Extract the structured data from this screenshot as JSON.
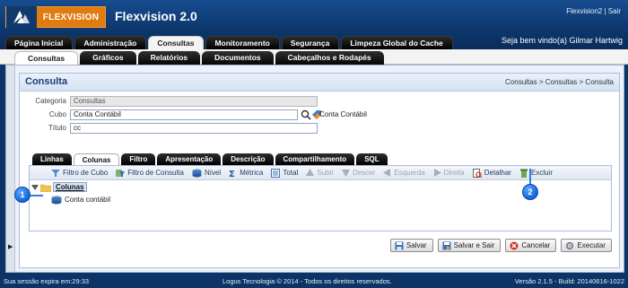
{
  "header": {
    "logo_text": "FLEXVISION",
    "app_title": "Flexvision 2.0",
    "user_link": "Flexvision2",
    "separator": "|",
    "exit_link": "Sair",
    "welcome": "Seja bem vindo(a) Gilmar Hartwig"
  },
  "main_tabs": [
    "Página Inicial",
    "Administração",
    "Consultas",
    "Monitoramento",
    "Segurança",
    "Limpeza Global do Cache"
  ],
  "sub_tabs": [
    "Consultas",
    "Gráficos",
    "Relatórios",
    "Documentos",
    "Cabeçalhos e Rodapés"
  ],
  "panel": {
    "title": "Consulta",
    "breadcrumb": "Consultas > Consultas > Consulta"
  },
  "form": {
    "categoria_label": "Categoria",
    "categoria_value": "Consultas",
    "cubo_label": "Cubo",
    "cubo_value": "Conta Contábil",
    "cubo_selected": "Conta Contábil",
    "titulo_label": "Título",
    "titulo_value": "cc"
  },
  "inner_tabs": [
    "Linhas",
    "Colunas",
    "Filtro",
    "Apresentação",
    "Descrição",
    "Compartilhamento",
    "SQL"
  ],
  "toolbar": {
    "filtro_cubo": "Filtro de Cubo",
    "filtro_consulta": "Filtro de Consulta",
    "nivel": "Nível",
    "metrica": "Métrica",
    "total": "Total",
    "subir": "Subir",
    "descer": "Descer",
    "esquerda": "Esquerda",
    "direita": "Direita",
    "detalhar": "Detalhar",
    "excluir": "Excluir"
  },
  "tree": {
    "root": "Colunas",
    "child": "Conta contábil"
  },
  "markers": [
    "1",
    "2"
  ],
  "buttons": {
    "salvar": "Salvar",
    "salvar_sair": "Salvar e Sair",
    "cancelar": "Cancelar",
    "executar": "Executar"
  },
  "footer": {
    "session": "Sua sessão expira em:29:33",
    "copyright": "Logus Tecnologia © 2014 - Todos os direitos reservados.",
    "version": "Versão 2.1.5 - Build: 20140616-1022"
  },
  "colors": {
    "header_bg": "#0c3467",
    "logo_orange": "#e07b10",
    "marker_blue": "#1565d8"
  }
}
